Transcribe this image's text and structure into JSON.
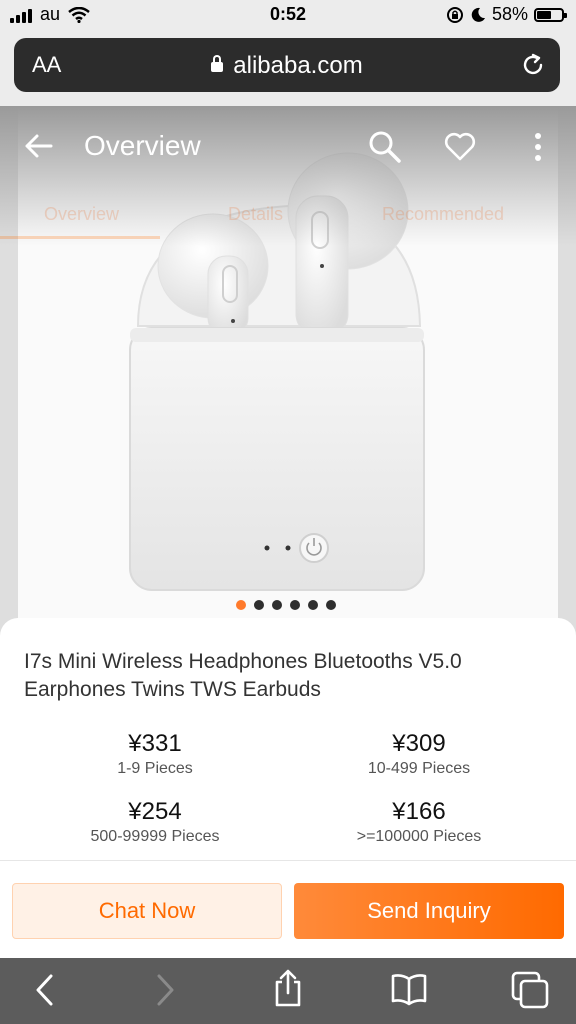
{
  "status_bar": {
    "carrier": "au",
    "time": "0:52",
    "battery": "58%",
    "battery_level": 0.58
  },
  "url_bar": {
    "text_size_label": "AA",
    "domain": "alibaba.com"
  },
  "header": {
    "title": "Overview"
  },
  "tabs": [
    {
      "label": "Overview"
    },
    {
      "label": "Details"
    },
    {
      "label": "Recommended"
    }
  ],
  "carousel": {
    "total": 6,
    "active_index": 0
  },
  "product": {
    "title": "I7s Mini Wireless Headphones Bluetooths V5.0 Earphones Twins TWS Earbuds",
    "price_tiers": [
      {
        "price": "¥331",
        "quantity": "1-9 Pieces"
      },
      {
        "price": "¥309",
        "quantity": "10-499 Pieces"
      },
      {
        "price": "¥254",
        "quantity": "500-99999 Pieces"
      },
      {
        "price": "¥166",
        "quantity": ">=100000 Pieces"
      }
    ]
  },
  "actions": {
    "chat": "Chat Now",
    "inquiry": "Send Inquiry"
  },
  "toolbar": {
    "icons": [
      "back-icon",
      "forward-icon",
      "share-icon",
      "bookmarks-icon",
      "tabs-icon"
    ]
  },
  "colors": {
    "accent": "#ff6a00",
    "dot_active": "#ff7a2b",
    "dot": "#2e2e2e"
  }
}
